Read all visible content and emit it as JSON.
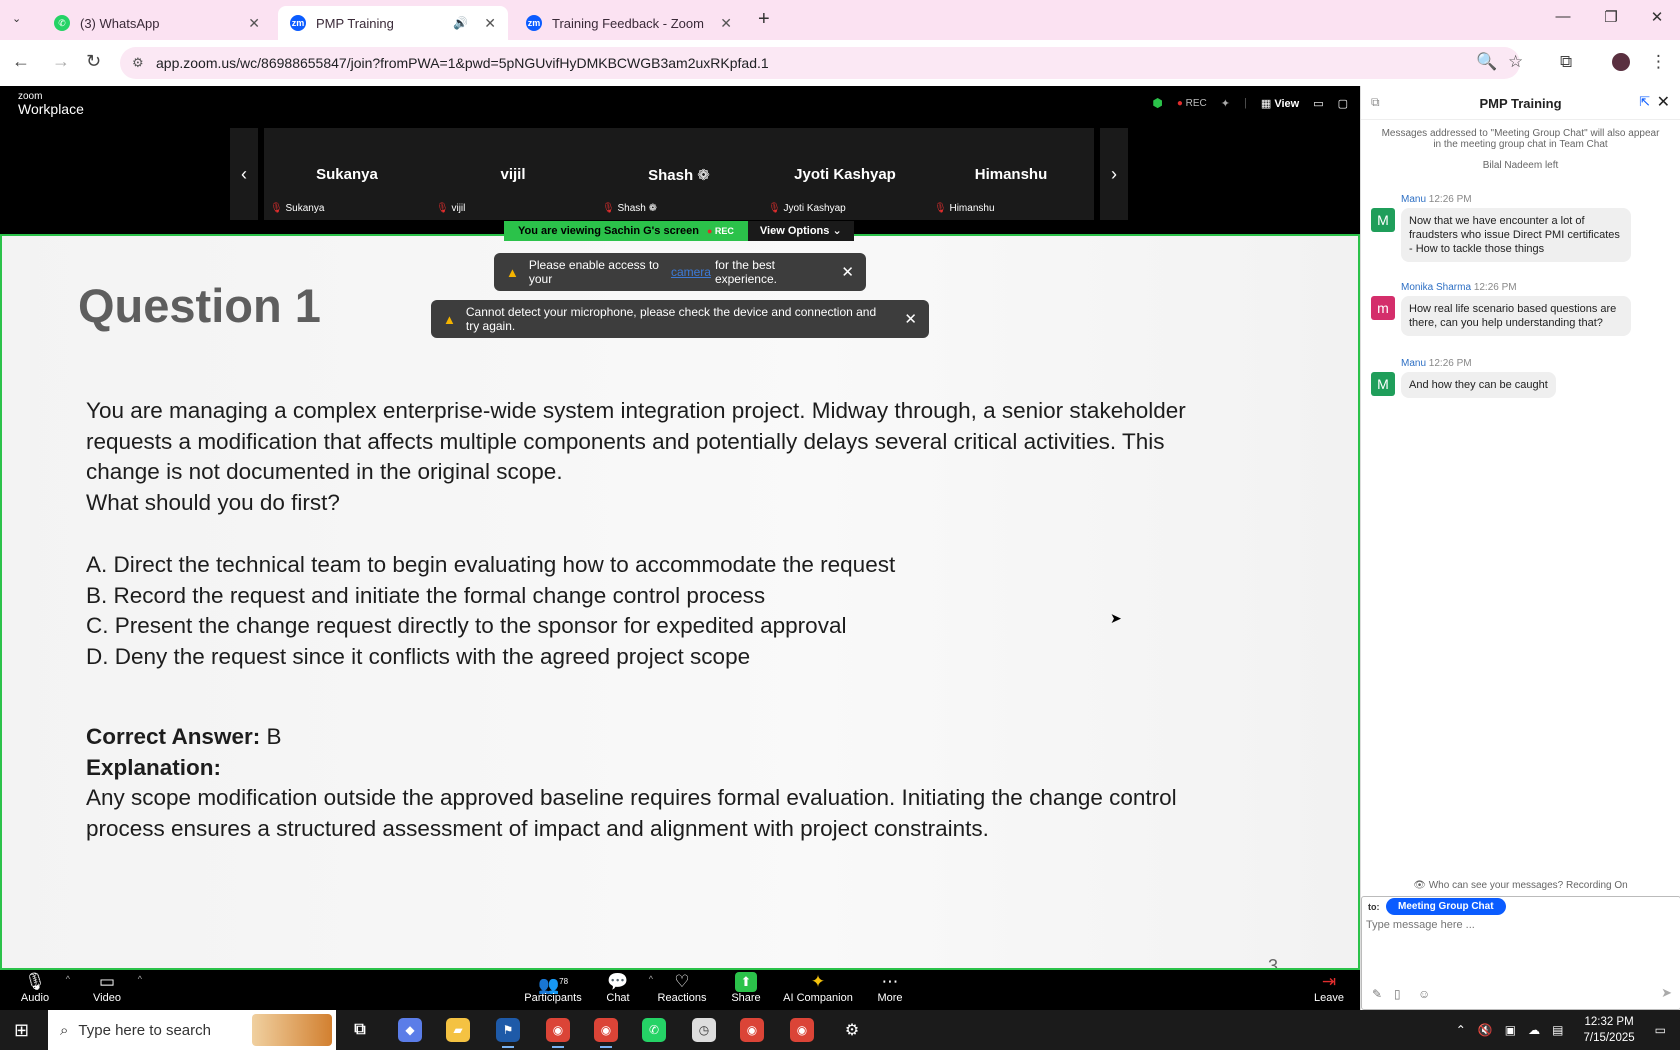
{
  "browser": {
    "tabs": [
      {
        "title": "(3) WhatsApp",
        "active": false
      },
      {
        "title": "PMP Training",
        "active": true
      },
      {
        "title": "Training Feedback - Zoom",
        "active": false
      }
    ],
    "url": "app.zoom.us/wc/86988655847/join?fromPWA=1&pwd=5pNGUvifHyDMKBCWGB3am2uxRKpfad.1"
  },
  "zoom": {
    "logo_small": "zoom",
    "logo_big": "Workplace",
    "rec_label": "REC",
    "view_label": "View",
    "participants_strip": [
      {
        "name": "Sukanya",
        "label": "Sukanya"
      },
      {
        "name": "vijil",
        "label": "vijil"
      },
      {
        "name": "Shash ❁",
        "label": "Shash ❁"
      },
      {
        "name": "Jyoti Kashyap",
        "label": "Jyoti Kashyap"
      },
      {
        "name": "Himanshu",
        "label": "Himanshu"
      }
    ],
    "viewing_banner": "You are viewing  Sachin G's screen",
    "viewing_rec": "REC",
    "view_options": "View Options",
    "notif1": {
      "before": "Please enable access to your",
      "link": "camera",
      "after": "for the best experience."
    },
    "notif2": "Cannot detect your microphone, please check the device and connection and try again.",
    "slide": {
      "title": "Question 1",
      "stem_lines": [
        "You are managing a complex enterprise-wide system integration project. Midway through, a senior stakeholder",
        "requests a modification that affects multiple components and potentially delays several critical activities. This",
        "change is not documented in the original scope.",
        "What should you do first?"
      ],
      "options": [
        "A. Direct the technical team to begin evaluating how to accommodate the request",
        "B. Record the request and initiate the formal change control process",
        "C. Present the change request directly to the sponsor for expedited approval",
        "D. Deny the request since it conflicts with the agreed project scope"
      ],
      "correct_label": "Correct Answer:",
      "correct_value": "B",
      "explanation_label": "Explanation:",
      "explanation_lines": [
        "Any scope modification outside the approved baseline requires formal evaluation. Initiating the change control",
        "process ensures a structured assessment of impact and alignment with project constraints."
      ],
      "page_number": "3"
    },
    "toolbar": {
      "audio": "Audio",
      "video": "Video",
      "participants": "Participants",
      "participants_count": "78",
      "chat": "Chat",
      "reactions": "Reactions",
      "share": "Share",
      "ai_companion": "AI Companion",
      "more": "More",
      "leave": "Leave"
    }
  },
  "chat": {
    "title": "PMP Training",
    "system_note": "Messages addressed to \"Meeting Group Chat\" will also appear in the meeting group chat in Team Chat",
    "left_note": "Bilal Nadeem left",
    "messages": [
      {
        "sender": "Manu",
        "time": "12:26 PM",
        "initial": "M",
        "color": "#1f9e5a",
        "text": "Now that we have encounter a lot of fraudsters who issue Direct PMI certificates - How to tackle those things"
      },
      {
        "sender": "Monika Sharma",
        "time": "12:26 PM",
        "initial": "m",
        "color": "#d42e6b",
        "text": "How real life scenario based questions are there, can you help understanding that?"
      },
      {
        "sender": "Manu",
        "time": "12:26 PM",
        "initial": "M",
        "color": "#1f9e5a",
        "text": "And how they can be caught"
      }
    ],
    "who_can_see": "Who can see your messages? Recording On",
    "to_label": "to:",
    "recipient": "Meeting Group Chat",
    "input_placeholder": "Type message here ..."
  },
  "taskbar": {
    "search_placeholder": "Type here to search",
    "time": "12:32 PM",
    "date": "7/15/2025"
  }
}
